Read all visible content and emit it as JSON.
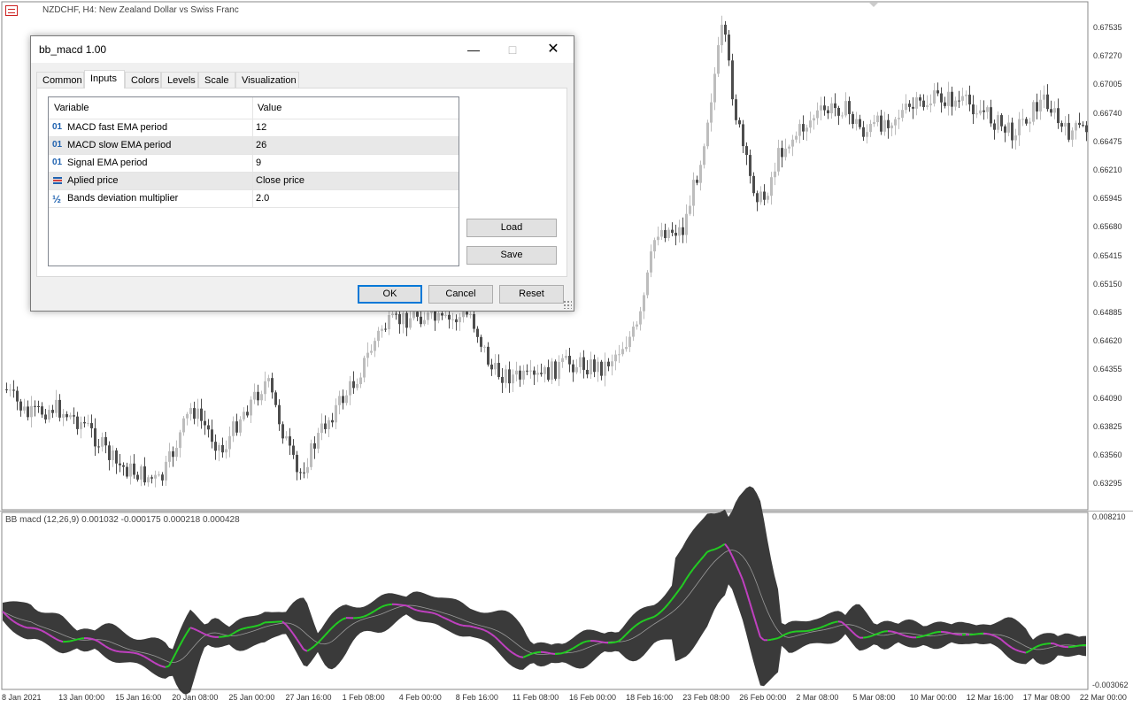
{
  "chart": {
    "title": "NZDCHF, H4:  New Zealand Dollar vs Swiss Franc",
    "price_axis": [
      "0.67535",
      "0.67270",
      "0.67005",
      "0.66740",
      "0.66475",
      "0.66210",
      "0.65945",
      "0.65680",
      "0.65415",
      "0.65150",
      "0.64885",
      "0.64620",
      "0.64355",
      "0.64090",
      "0.63825",
      "0.63560",
      "0.63295"
    ],
    "time_axis": [
      "8 Jan 2021",
      "13 Jan 00:00",
      "15 Jan 16:00",
      "20 Jan 08:00",
      "25 Jan 00:00",
      "27 Jan 16:00",
      "1 Feb 08:00",
      "4 Feb 00:00",
      "8 Feb 16:00",
      "11 Feb 08:00",
      "16 Feb 00:00",
      "18 Feb 16:00",
      "23 Feb 08:00",
      "26 Feb 00:00",
      "2 Mar 08:00",
      "5 Mar 08:00",
      "10 Mar 00:00",
      "12 Mar 16:00",
      "17 Mar 08:00",
      "22 Mar 00:00"
    ],
    "colors": {
      "candle_bull": "#bdbdbd",
      "candle_bear": "#4d4d4d",
      "band_fill": "#3a3a3a",
      "macd_up": "#22cc22",
      "macd_down": "#c040c0",
      "signal": "#9a9a9a"
    }
  },
  "indicator": {
    "title": "BB macd (12,26,9) 0.001032 -0.000175 0.000218 0.000428",
    "axis_top": "0.008210",
    "axis_bottom": "-0.003062"
  },
  "dialog": {
    "title": "bb_macd 1.00",
    "tabs": [
      "Common",
      "Inputs",
      "Colors",
      "Levels",
      "Scale",
      "Visualization"
    ],
    "active_tab": "Inputs",
    "headers": {
      "variable": "Variable",
      "value": "Value"
    },
    "rows": [
      {
        "icon": "01",
        "icon_name": "integer-icon",
        "variable": "MACD fast EMA period",
        "value": "12"
      },
      {
        "icon": "01",
        "icon_name": "integer-icon",
        "variable": "MACD slow EMA period",
        "value": "26"
      },
      {
        "icon": "01",
        "icon_name": "integer-icon",
        "variable": "Signal EMA period",
        "value": "9"
      },
      {
        "icon": "",
        "icon_name": "enum-icon",
        "variable": "Aplied price",
        "value": "Close price"
      },
      {
        "icon": "½",
        "icon_name": "double-icon",
        "variable": "Bands deviation multiplier",
        "value": "2.0"
      }
    ],
    "buttons": {
      "load": "Load",
      "save": "Save",
      "ok": "OK",
      "cancel": "Cancel",
      "reset": "Reset"
    }
  }
}
